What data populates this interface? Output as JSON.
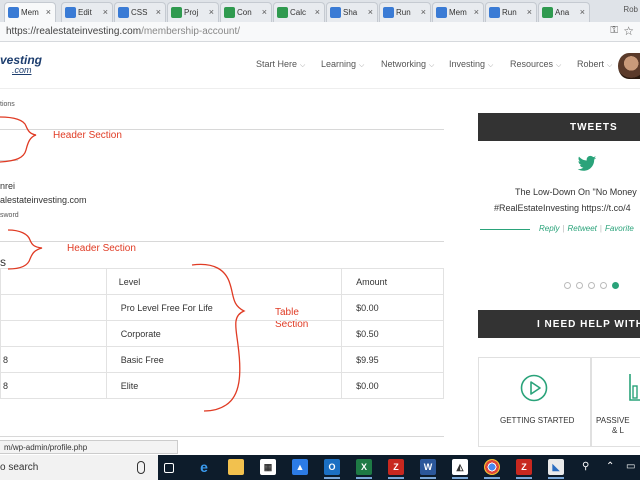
{
  "browser": {
    "tabs": [
      {
        "label": "Mem",
        "favicon": "rei-favicon"
      },
      {
        "label": "Edit",
        "favicon": "rei-favicon"
      },
      {
        "label": "CSS",
        "favicon": "rei-favicon"
      },
      {
        "label": "Proj",
        "favicon": "sheets-favicon"
      },
      {
        "label": "Con",
        "favicon": "sheets-favicon"
      },
      {
        "label": "Calc",
        "favicon": "sheets-favicon"
      },
      {
        "label": "Sha",
        "favicon": "rei-favicon"
      },
      {
        "label": "Run",
        "favicon": "rei-favicon"
      },
      {
        "label": "Mem",
        "favicon": "rei-favicon"
      },
      {
        "label": "Run",
        "favicon": "rei-favicon"
      },
      {
        "label": "Ana",
        "favicon": "sheets-favicon"
      }
    ],
    "tab_close_glyph": "×",
    "profile_label": "Rob",
    "url_host": "https://realestateinvesting.com",
    "url_path": "/membership-account/"
  },
  "site": {
    "logo_top": "vesting",
    "logo_bottom": ".com",
    "nav": [
      "Start Here",
      "Learning",
      "Networking",
      "Investing",
      "Resources",
      "Robert"
    ]
  },
  "content": {
    "breadcrumb_fragment": "tions",
    "name_fragment": "nrei",
    "email_fragment": "alestateinvesting.com",
    "password_fragment": "sword",
    "subscriptions_heading_fragment": "s",
    "annotations": {
      "header_1": "Header Section",
      "header_2": "Header Section",
      "table": "Table\nSection"
    },
    "table": {
      "headers": [
        "",
        "Level",
        "Amount"
      ],
      "rows": [
        {
          "date": "",
          "level": "Pro Level Free For Life",
          "amount": "$0.00"
        },
        {
          "date": "",
          "level": "Corporate",
          "amount": "$0.50"
        },
        {
          "date": "8",
          "level": "Basic Free",
          "amount": "$9.95"
        },
        {
          "date": "8",
          "level": "Elite",
          "amount": "$0.00"
        }
      ]
    },
    "status_url": "m/wp-admin/profile.php"
  },
  "sidebar": {
    "tweets_title": "TWEETS",
    "tweet_line_1": "The Low-Down On \"No Money",
    "tweet_line_2": "#RealEstateInvesting https://t.co/4",
    "actions": [
      "Reply",
      "Retweet",
      "Favorite"
    ],
    "dots_total": 5,
    "dots_active_index": 4,
    "help_title": "I NEED HELP WITH...",
    "help_items": [
      {
        "label": "GETTING STARTED",
        "icon": "play-icon"
      },
      {
        "label_line_1": "PASSIVE",
        "label_line_2": "& L",
        "icon": "bar-chart-icon"
      }
    ],
    "accent_color": "#2aa37a"
  },
  "taskbar": {
    "search_text": "o search",
    "apps": [
      "task-view",
      "edge",
      "file-explorer",
      "store",
      "photos",
      "outlook",
      "excel",
      "filezilla",
      "word",
      "image-viewer",
      "chrome",
      "filezilla",
      "pdf-app"
    ]
  }
}
